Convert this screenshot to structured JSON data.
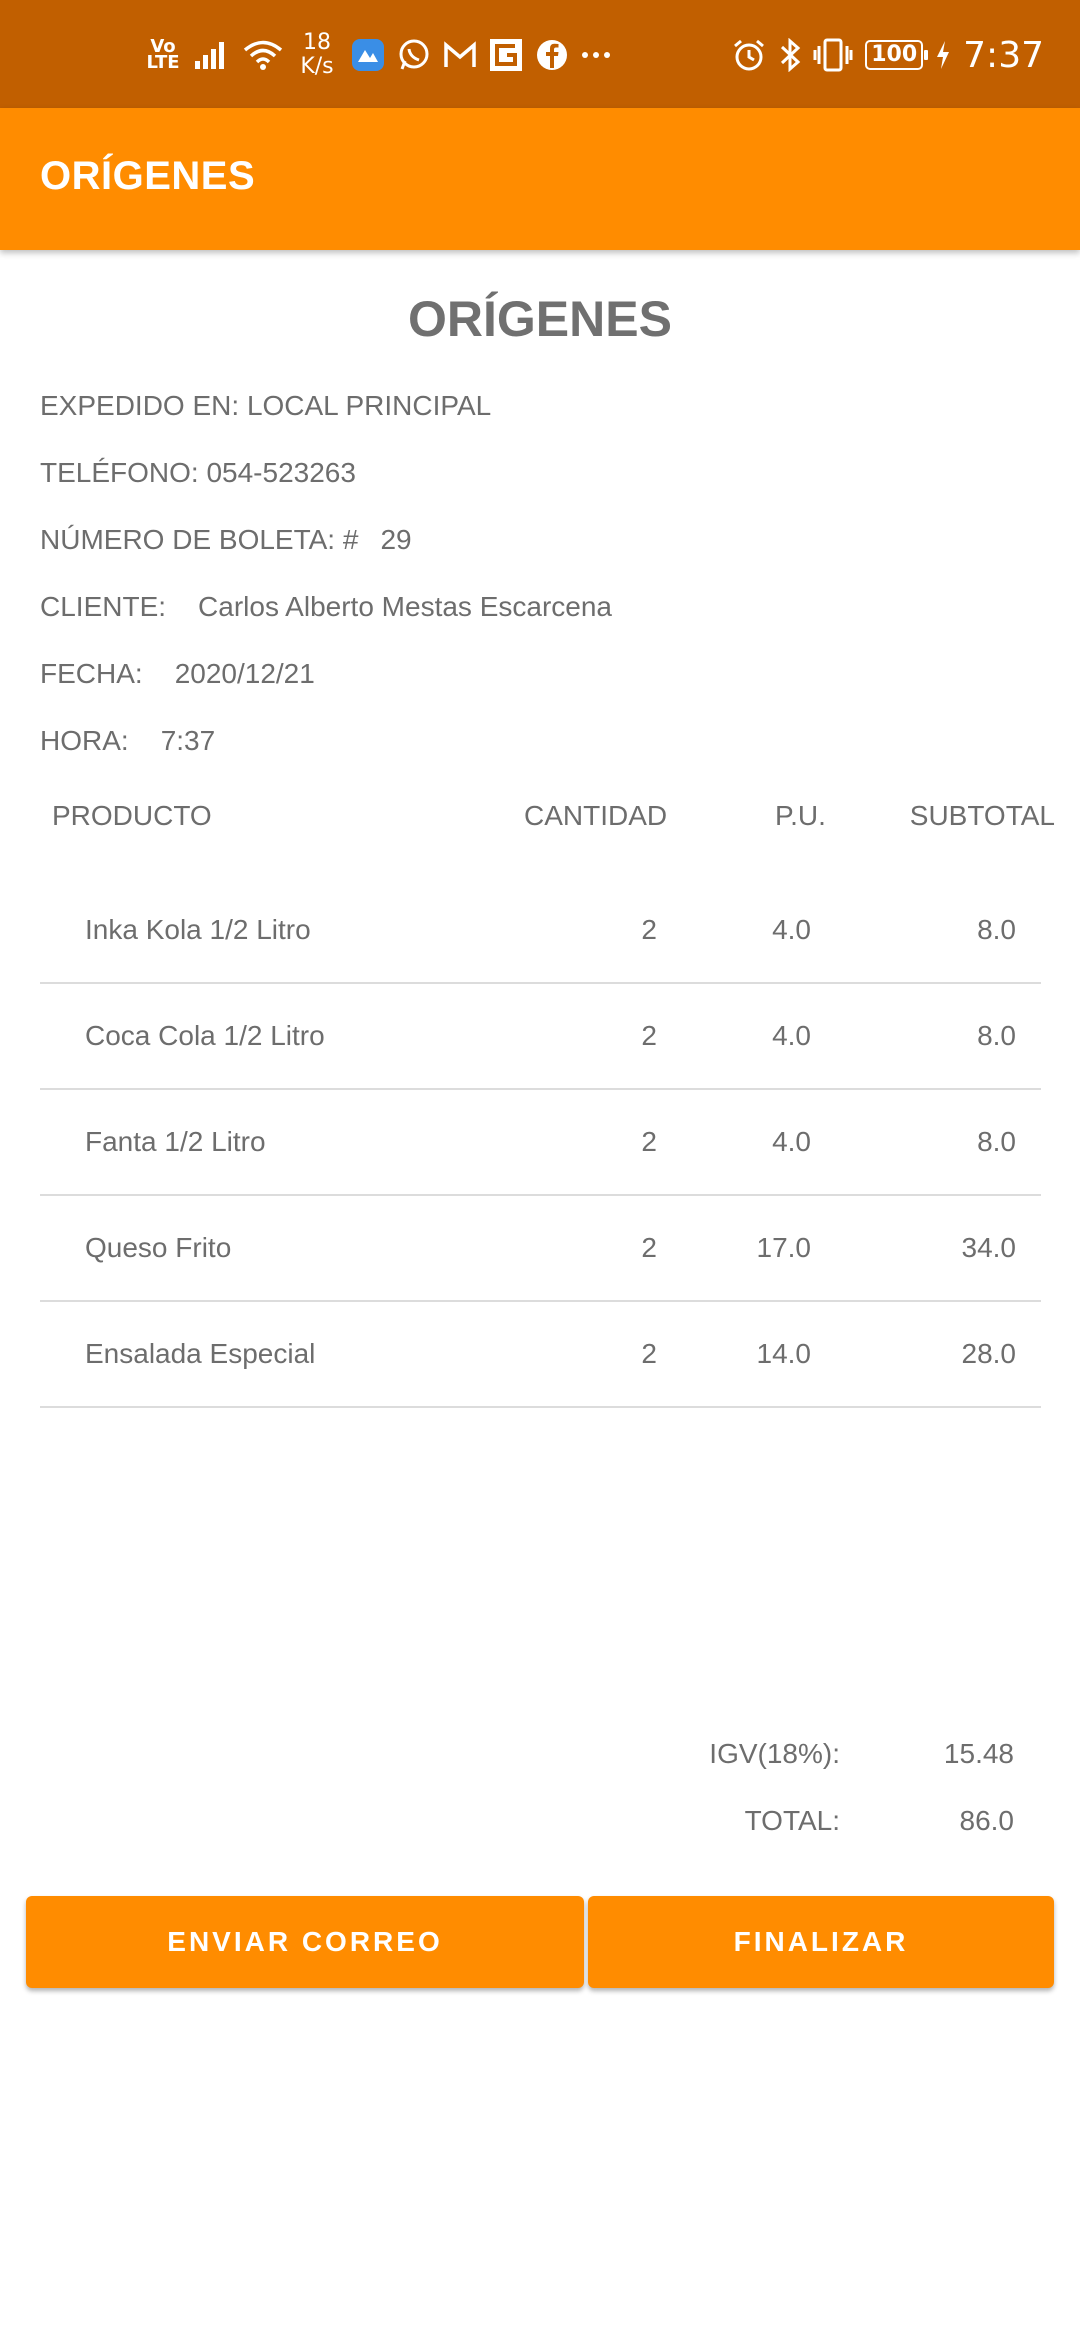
{
  "status_bar": {
    "network_label": "Vo\nLTE",
    "speed_value": "18",
    "speed_unit": "K/s",
    "battery": "100",
    "time": "7:37",
    "icons": [
      "signal-icon",
      "wifi-icon",
      "app-icon",
      "whatsapp-icon",
      "gmail-icon",
      "app-g-icon",
      "facebook-icon",
      "more-icon",
      "alarm-icon",
      "bluetooth-icon",
      "vibrate-icon",
      "charging-icon"
    ]
  },
  "app_bar": {
    "title": "ORÍGENES"
  },
  "receipt": {
    "title": "ORÍGENES",
    "issued_at": "EXPEDIDO EN: LOCAL PRINCIPAL",
    "phone": "TELÉFONO: 054-523263",
    "ticket_label": "NÚMERO DE BOLETA: #",
    "ticket_value": "29",
    "client_label": "CLIENTE:",
    "client_value": "Carlos Alberto Mestas Escarcena",
    "date_label": "FECHA:",
    "date_value": "2020/12/21",
    "time_label": "HORA:",
    "time_value": "7:37"
  },
  "table": {
    "headers": {
      "product": "PRODUCTO",
      "quantity": "CANTIDAD",
      "unit_price": "P.U.",
      "subtotal": "SUBTOTAL"
    },
    "rows": [
      {
        "product": "Inka Kola 1/2 Litro",
        "quantity": "2",
        "unit_price": "4.0",
        "subtotal": "8.0"
      },
      {
        "product": "Coca Cola 1/2 Litro",
        "quantity": "2",
        "unit_price": "4.0",
        "subtotal": "8.0"
      },
      {
        "product": "Fanta 1/2 Litro",
        "quantity": "2",
        "unit_price": "4.0",
        "subtotal": "8.0"
      },
      {
        "product": "Queso Frito",
        "quantity": "2",
        "unit_price": "17.0",
        "subtotal": "34.0"
      },
      {
        "product": "Ensalada Especial",
        "quantity": "2",
        "unit_price": "14.0",
        "subtotal": "28.0"
      }
    ]
  },
  "totals": {
    "igv_label": "IGV(18%):",
    "igv_value": "15.48",
    "total_label": "TOTAL:",
    "total_value": "86.0"
  },
  "buttons": {
    "send_email": "ENVIAR CORREO",
    "finish": "FINALIZAR"
  },
  "colors": {
    "status_bar": "#c15f00",
    "accent": "#ff8c00",
    "text": "#6d6d6d"
  }
}
